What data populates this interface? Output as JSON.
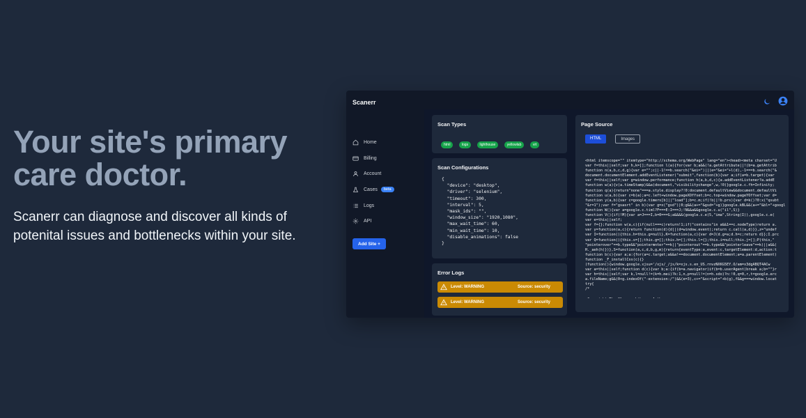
{
  "hero": {
    "title": "Your site's primary care doctor.",
    "subtitle": "Scanerr can diagnose and discover all kinds of potenital issues and bottlenecks within your site."
  },
  "app": {
    "brand": "Scanerr",
    "nav": [
      {
        "label": "Home",
        "icon": "home-icon"
      },
      {
        "label": "Billing",
        "icon": "billing-icon"
      },
      {
        "label": "Account",
        "icon": "user-icon"
      },
      {
        "label": "Cases",
        "icon": "flask-icon",
        "badge": "beta"
      },
      {
        "label": "Logs",
        "icon": "list-icon"
      },
      {
        "label": "API",
        "icon": "gear-icon"
      }
    ],
    "add_site": "Add Site +",
    "scan_types": {
      "title": "Scan Types",
      "tags": [
        "html",
        "logs",
        "lighthouse",
        "yellowlab",
        "vrt"
      ]
    },
    "scan_config": {
      "title": "Scan Configurations",
      "body": "{\n  \"device\": \"desktop\",\n  \"driver\": \"selenium\",\n  \"timeout\": 300,\n  \"interval\": 5,\n  \"mask_ids\": \"\",\n  \"window_size\": \"1920,1080\",\n  \"max_wait_time\": 60,\n  \"min_wait_time\": 10,\n  \"disable_animations\": false\n}"
    },
    "error_logs": {
      "title": "Error Logs",
      "items": [
        {
          "level": "Level: WARNING",
          "source": "Source: security"
        },
        {
          "level": "Level: WARNING",
          "source": "Source: security"
        }
      ]
    },
    "page_source": {
      "title": "Page Source",
      "tab_html": "HTML",
      "tab_images": "Images",
      "code": "<html itemscope=\"\" itemtype=\"http://schema.org/WebPage\" lang=\"en\"><head><meta charset=\"U\nvar f=this||self;var h,k=[];function l(a){for(var b;a&&(!a.getAttribute||!(b=a.getAttrib\nfunction n(a,b,c,d,g){var e=\"\";c||-1!==b.search(\"&ei=\")||(e=\"&ei=\"+l(d),-1===b.search(\"&\ndocument.documentElement.addEventListener(\"submit\",function(b){var a;if(a=b.target){var\nvar f=this||self;var g=window.performance;function h(a,b,d,c){a.addEventListener?a.addE\nfunction w(a){v(a.timeStamp)&&a(document,\"visibilitychange\",w,!0)}google.c.fh=Infinity;\nfunction q(a){return\"none\"===a.style.display?!0:document.defaultView&&document.defaultVi\nfunction u(a,b){var c=b(a);a=c.left+window.pageXOffset;b=c.top+window.pageYOffset;var d=\nfunction y(a,b){var c=google.timers[b]||\"load\"];b=c.m;if(!b||!b.prs){var d=k()?0:x(\"qsubt\n\"&r=1\");var f=\"gsasrt\" in b)(var g=x(\"gsd\")|0;g&&(a+=\"&gsd=\"+g)}google.kBL&&(a+=\"&bl=\"+googl\nfunction W(){var a=google.c.timl?F===E:I===J;!N&&a&&google.c.u(\"il\",S)}\nfunction V(){if(!M){var a=J===I,b=0===G;a&&&&(google.c.e(5,\"ima\",String(I)),google.c.e(\nvar e=this||self;\nvar f={};function w(a,c){if(null===c)return!1;if(\"contains\"in a&&1==c.nodeType)return a.\nvar y=function(a,c){return function(d){d||(d=window.event);return c.call(a,d)}},z=\"undef\nvar I=function(){this.h=this.g=null},K=function(a,c){var d=J(d.g=a;d.h=c;return d}};I.prc\nvar Q=function(){this.s=[];this.g=[];this.h=[];this.l={};this.i=null;this.j=[];P(this,\"\n\"pointerover\"==b.type&&\"pointermnter\"==k||\"pointerout\"==b.type&&\"pointerleave\"==k)||a&&(\nH._aeh(h)})},S=function(a,c,d,b,g,m){return{eventType:a,event:c,targetElement:d,action:t\nfunction b(c){var a;a:{for(a=c.target;a&&a!==document.documentElement;a=a.parentElement)\nfunction _F_installCss(c){}\n(function(){window.google.xjsu='/xjs/_/js/k=xjs.s.en_US.rnvzNXKG5EY.O/am=x3dgABQT4ACw\nvar a=this||self;function d(c){var b;a:{if(b=a.navigator)if(b=b.userAgent)break a;b=\"\"}r\nvar h=this||self;var k,l=null!=(k=h.mei)?k:1,n,p=null!=(n=h.sdo)?n:!0,q=0,r,t=google.erc\na.fileName;g&&(0<g.indexOf(\"-extension:/\")&&(e=3),c+=\"&script=\"+b(g),f&&g===window.locat\ntry{\n/*\n\n Copyright The Closure Library Authors."
    }
  }
}
